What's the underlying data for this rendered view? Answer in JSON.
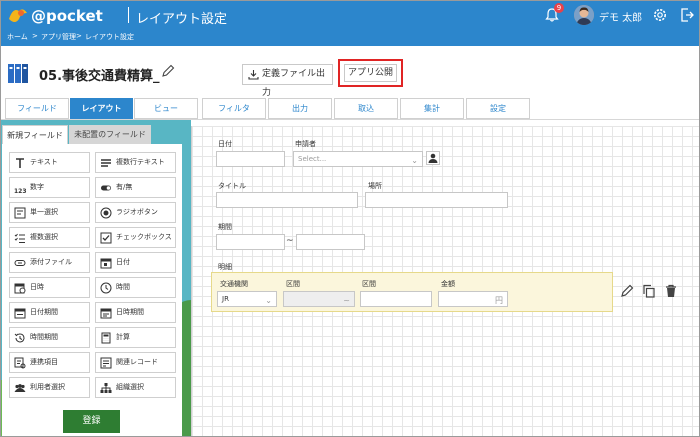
{
  "header": {
    "logo_text": "@pocket",
    "page_title": "レイアウト設定",
    "notification_count": "9",
    "user_name": "デモ 太郎"
  },
  "breadcrumb": [
    "ホーム",
    "アプリ管理",
    "レイアウト設定"
  ],
  "breadcrumb_separator": ">",
  "app": {
    "title": "05.事後交通費精算_",
    "export_label": "定義ファイル出力",
    "publish_label": "アプリ公開"
  },
  "tabs": [
    {
      "label": "フィールド",
      "active": false
    },
    {
      "label": "レイアウト",
      "active": true
    },
    {
      "label": "ビュー",
      "active": false
    },
    {
      "label": "フィルタ",
      "active": false
    },
    {
      "label": "出力",
      "active": false
    },
    {
      "label": "取込",
      "active": false
    },
    {
      "label": "集計",
      "active": false
    },
    {
      "label": "設定",
      "active": false
    }
  ],
  "palette": {
    "tab_new": "新規フィールド",
    "tab_unplaced": "未配置のフィールド",
    "items": [
      {
        "label": "テキスト",
        "icon": "text-icon"
      },
      {
        "label": "複数行テキスト",
        "icon": "multiline-icon"
      },
      {
        "label": "数字",
        "icon": "number-icon"
      },
      {
        "label": "有/無",
        "icon": "toggle-icon"
      },
      {
        "label": "単一選択",
        "icon": "single-select-icon"
      },
      {
        "label": "ラジオボタン",
        "icon": "radio-icon"
      },
      {
        "label": "複数選択",
        "icon": "multi-select-icon"
      },
      {
        "label": "チェックボックス",
        "icon": "checkbox-icon"
      },
      {
        "label": "添付ファイル",
        "icon": "attachment-icon"
      },
      {
        "label": "日付",
        "icon": "calendar-icon"
      },
      {
        "label": "日時",
        "icon": "datetime-icon"
      },
      {
        "label": "時間",
        "icon": "clock-icon"
      },
      {
        "label": "日付期間",
        "icon": "date-range-icon"
      },
      {
        "label": "日時期間",
        "icon": "datetime-range-icon"
      },
      {
        "label": "時間期間",
        "icon": "time-range-icon"
      },
      {
        "label": "計算",
        "icon": "calculator-icon"
      },
      {
        "label": "連携項目",
        "icon": "linked-field-icon"
      },
      {
        "label": "関連レコード",
        "icon": "related-record-icon"
      },
      {
        "label": "利用者選択",
        "icon": "users-icon"
      },
      {
        "label": "組織選択",
        "icon": "org-icon"
      }
    ],
    "register_label": "登録"
  },
  "form": {
    "date_label": "日付",
    "applicant_label": "申請者",
    "applicant_placeholder": "Select...",
    "title_label": "タイトル",
    "place_label": "場所",
    "period_label": "期間",
    "period_separator": "~",
    "detail_label": "明細",
    "detail_columns": [
      "交通機関",
      "区間",
      "区間",
      "金額"
    ],
    "transport_value": "JR",
    "section_separator": "~",
    "amount_unit": "円"
  },
  "colors": {
    "header_blue": "#2c86cc",
    "highlight_red": "#e02424",
    "register_green": "#2e7d32",
    "detail_bg": "#fbf6dc"
  }
}
